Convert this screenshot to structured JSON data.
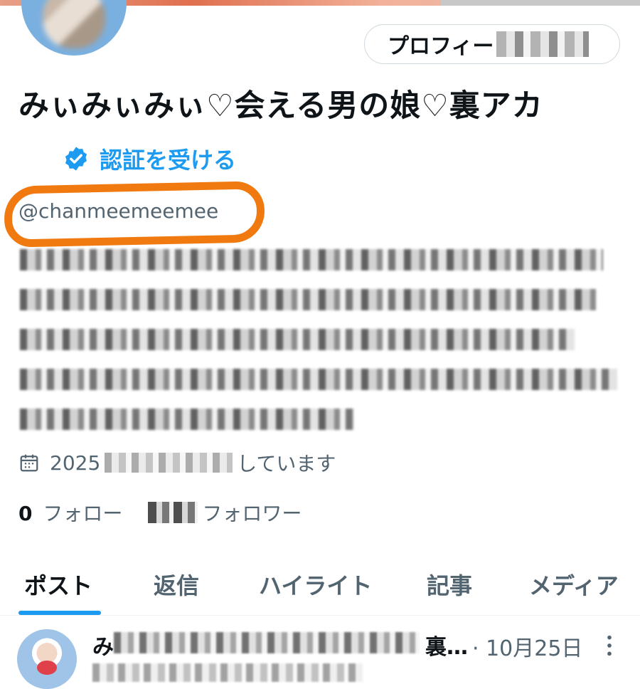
{
  "header": {
    "edit_profile_label": "プロフィー"
  },
  "profile": {
    "display_name": "みぃみぃみぃ♡会える男の娘♡裏アカ",
    "verify_label": "認証を受ける",
    "handle": "@chanmeemeemee",
    "joined_text_visible": "2025",
    "joined_suffix": "しています",
    "following_count": "0",
    "following_label": "フォロー",
    "followers_label": "フォロワー"
  },
  "tabs": [
    {
      "label": "ポスト",
      "active": true
    },
    {
      "label": "返信",
      "active": false
    },
    {
      "label": "ハイライト",
      "active": false
    },
    {
      "label": "記事",
      "active": false
    },
    {
      "label": "メディア",
      "active": false
    }
  ],
  "post": {
    "name_prefix": "み",
    "name_suffix": "裏…",
    "date": "· 10月25日"
  },
  "colors": {
    "accent": "#1d9bf0",
    "highlight_circle": "#f07a10",
    "text_primary": "#0f1419",
    "text_secondary": "#536471"
  }
}
